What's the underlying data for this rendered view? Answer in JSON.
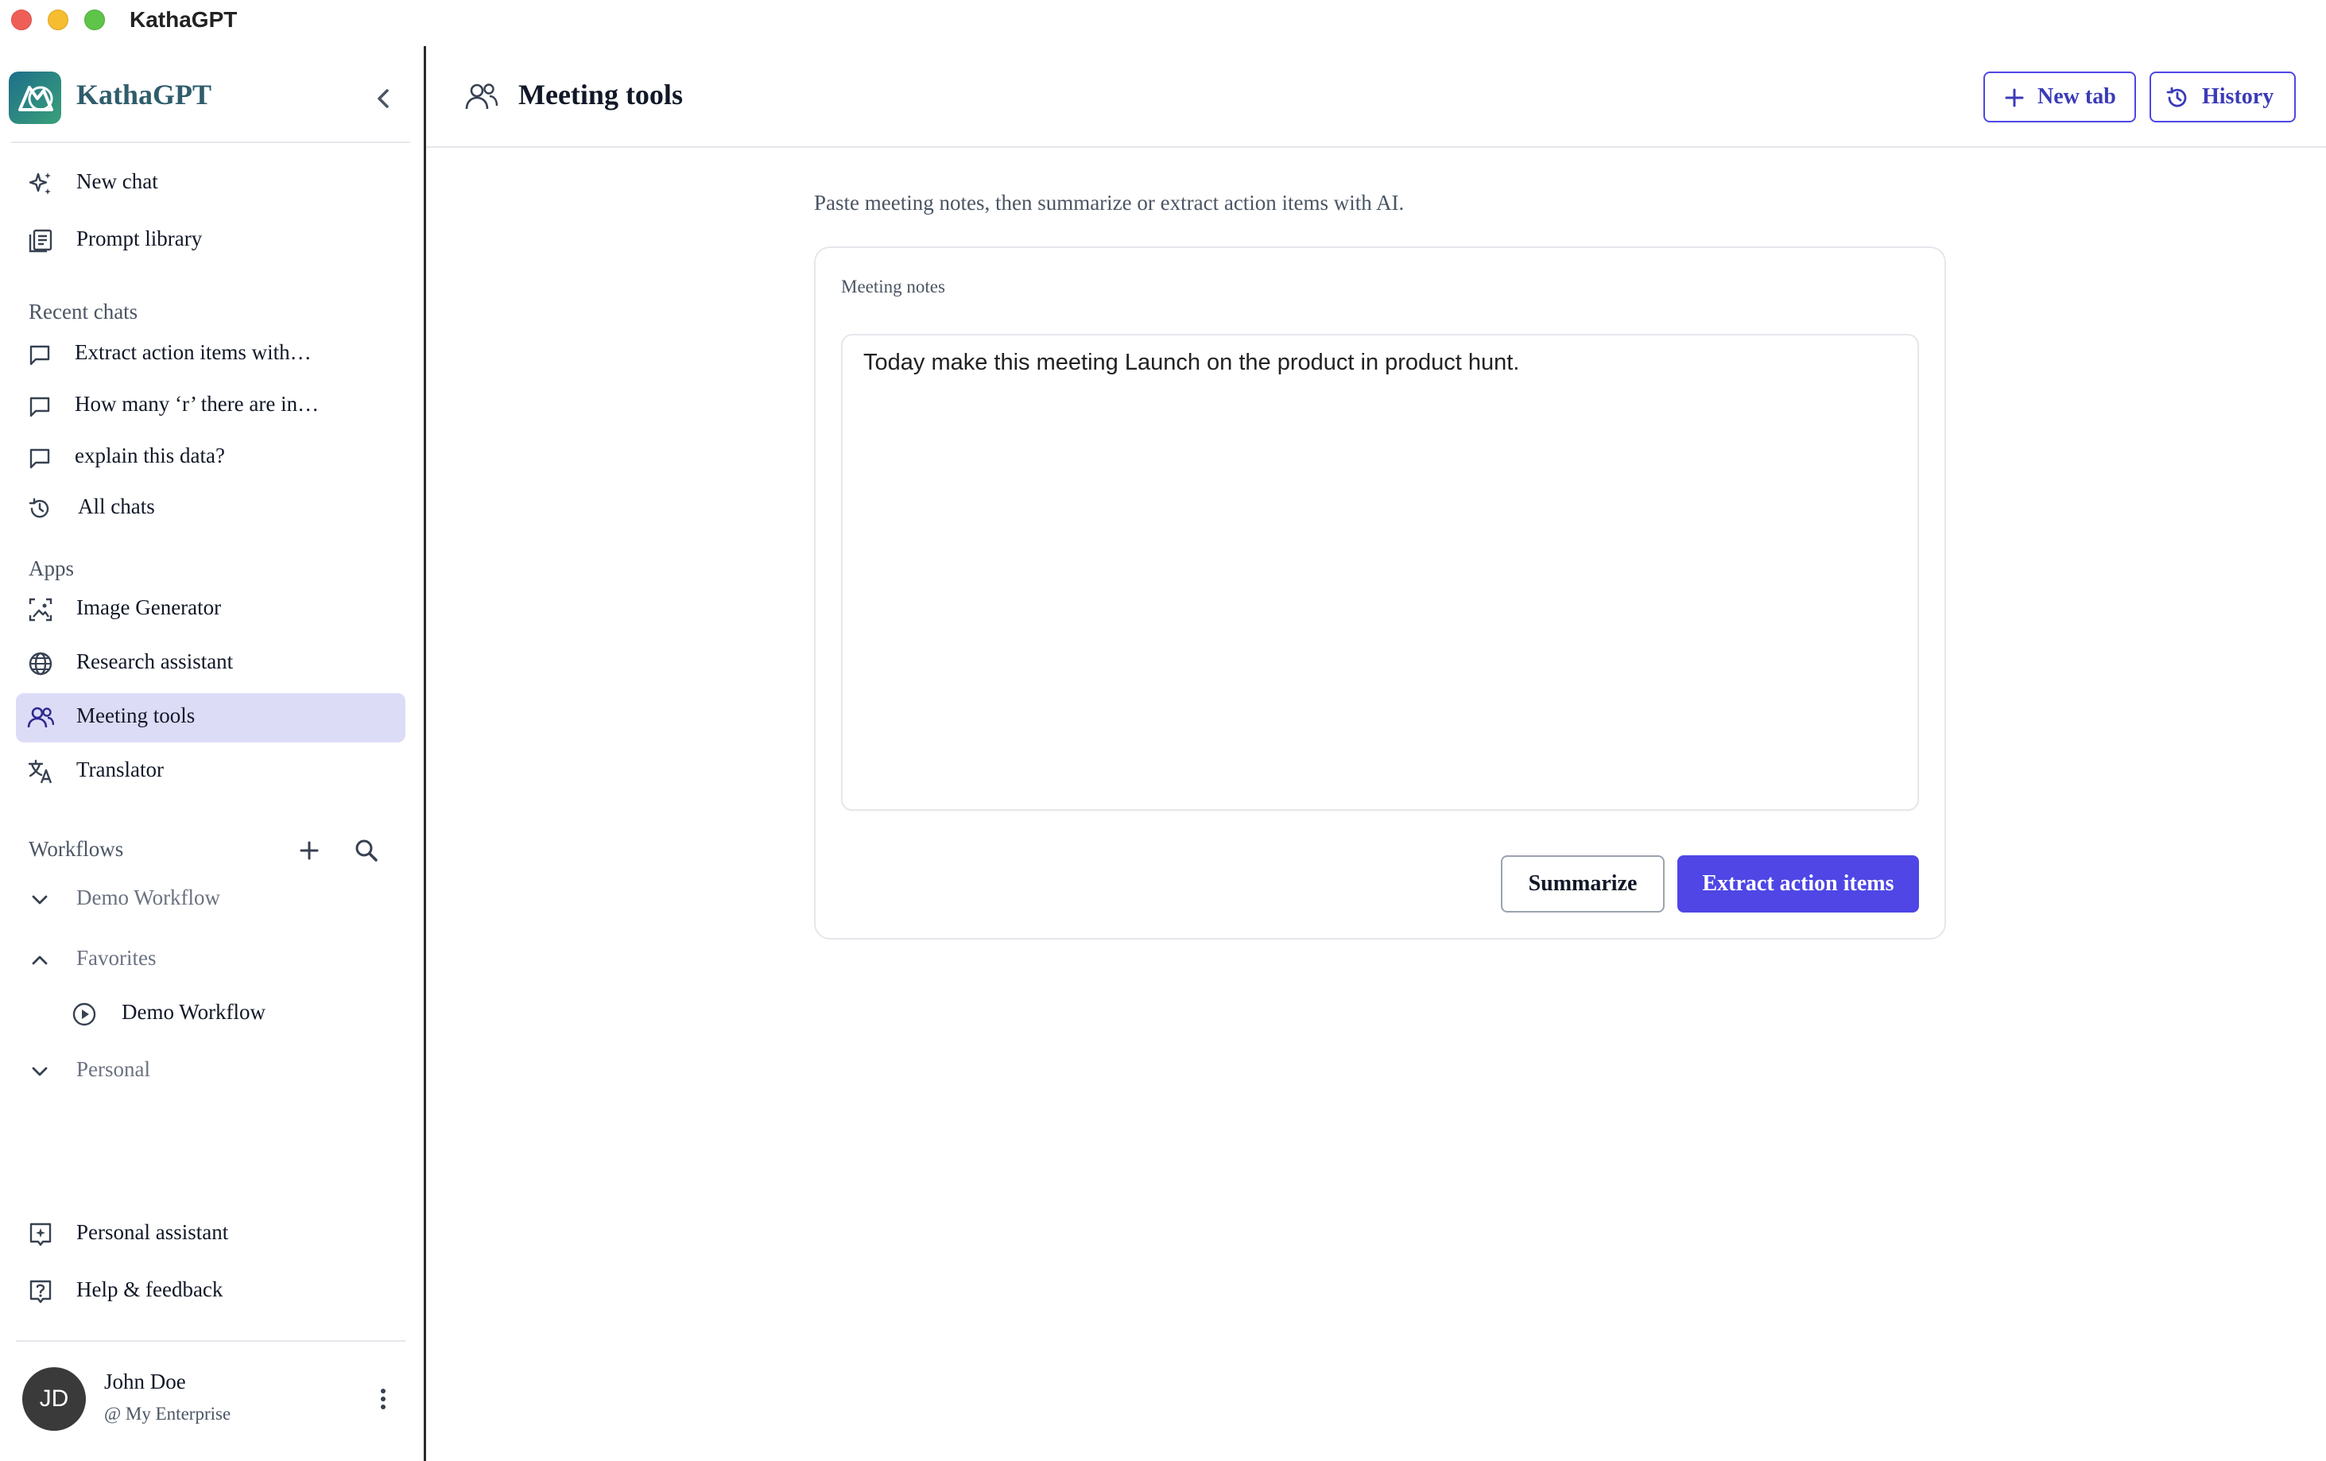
{
  "window": {
    "title": "KathaGPT"
  },
  "brand": {
    "name": "KathaGPT"
  },
  "sidebar": {
    "nav": [
      {
        "label": "New chat",
        "icon": "sparkles-icon"
      },
      {
        "label": "Prompt library",
        "icon": "library-icon"
      }
    ],
    "recent_title": "Recent chats",
    "recent": [
      {
        "label": "Extract action items with…",
        "icon": "chat-bubble-icon"
      },
      {
        "label": "How many ‘r’ there are in…",
        "icon": "chat-bubble-icon"
      },
      {
        "label": "explain this data?",
        "icon": "chat-bubble-icon"
      }
    ],
    "all_chats": "All chats",
    "apps_title": "Apps",
    "apps": [
      {
        "label": "Image Generator",
        "icon": "image-generator-icon"
      },
      {
        "label": "Research assistant",
        "icon": "globe-icon"
      },
      {
        "label": "Meeting tools",
        "icon": "users-icon",
        "active": true
      },
      {
        "label": "Translator",
        "icon": "translate-icon"
      }
    ],
    "workflows_title": "Workflows",
    "workflows": [
      {
        "label": "Demo Workflow",
        "icon": "chevron-down-icon"
      },
      {
        "label": "Favorites",
        "icon": "chevron-up-icon"
      },
      {
        "label": "Demo Workflow",
        "icon": "play-circle-icon"
      },
      {
        "label": "Personal",
        "icon": "chevron-down-icon"
      }
    ],
    "bottom": [
      {
        "label": "Personal assistant",
        "icon": "assistant-icon"
      },
      {
        "label": "Help & feedback",
        "icon": "help-icon"
      }
    ],
    "user": {
      "initials": "JD",
      "name": "John Doe",
      "org": "@ My Enterprise"
    }
  },
  "header": {
    "title": "Meeting tools",
    "new_tab": "New tab",
    "history": "History"
  },
  "main": {
    "description": "Paste meeting notes, then summarize or extract action items with AI.",
    "notes_label": "Meeting notes",
    "notes_value": "Today make this meeting Launch on the product in product hunt.",
    "summarize": "Summarize",
    "extract": "Extract action items"
  },
  "colors": {
    "accent": "#4f46e5",
    "active_bg": "#dddcf7"
  }
}
